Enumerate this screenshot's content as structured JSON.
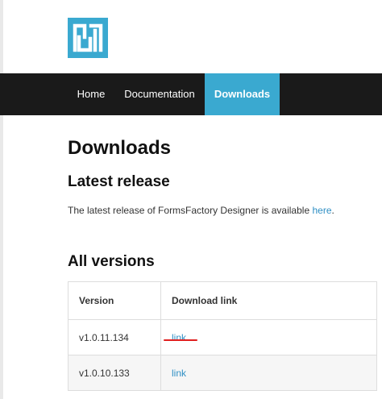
{
  "nav": {
    "items": [
      {
        "label": "Home"
      },
      {
        "label": "Documentation"
      },
      {
        "label": "Downloads",
        "active": true
      }
    ]
  },
  "page": {
    "title": "Downloads",
    "latest_heading": "Latest release",
    "release_text": "The latest release of FormsFactory Designer is available ",
    "release_link": "here",
    "release_suffix": ".",
    "all_heading": "All versions"
  },
  "table": {
    "headers": [
      "Version",
      "Download link"
    ],
    "rows": [
      {
        "version": "v1.0.11.134",
        "link": "link"
      },
      {
        "version": "v1.0.10.133",
        "link": "link"
      }
    ]
  },
  "colors": {
    "navbar": "#1a1a1a",
    "active_tab": "#3aa9d0",
    "link": "#2f8fc4",
    "logo": "#3aa9d0",
    "annotation": "#e02020"
  },
  "icons": {
    "logo": "formsfactory-logo-icon"
  }
}
